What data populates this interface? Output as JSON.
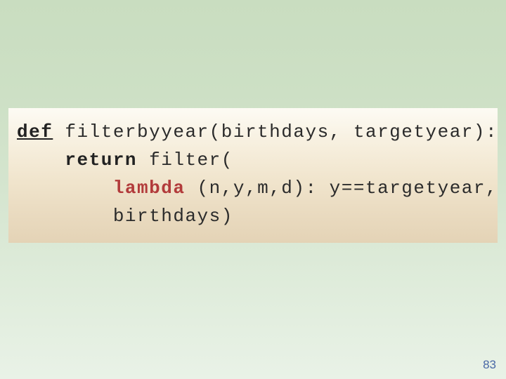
{
  "code": {
    "line1": {
      "kw_def": "def",
      "rest": " filterbyyear(birthdays, targetyear):"
    },
    "line2": {
      "indent": "    ",
      "kw_return": "return",
      "rest": " filter("
    },
    "line3": {
      "indent": "        ",
      "kw_lambda": "lambda",
      "rest": " (n,y,m,d): y==targetyear,"
    },
    "line4": {
      "indent": "        ",
      "rest": "birthdays)"
    }
  },
  "page_number": "83"
}
